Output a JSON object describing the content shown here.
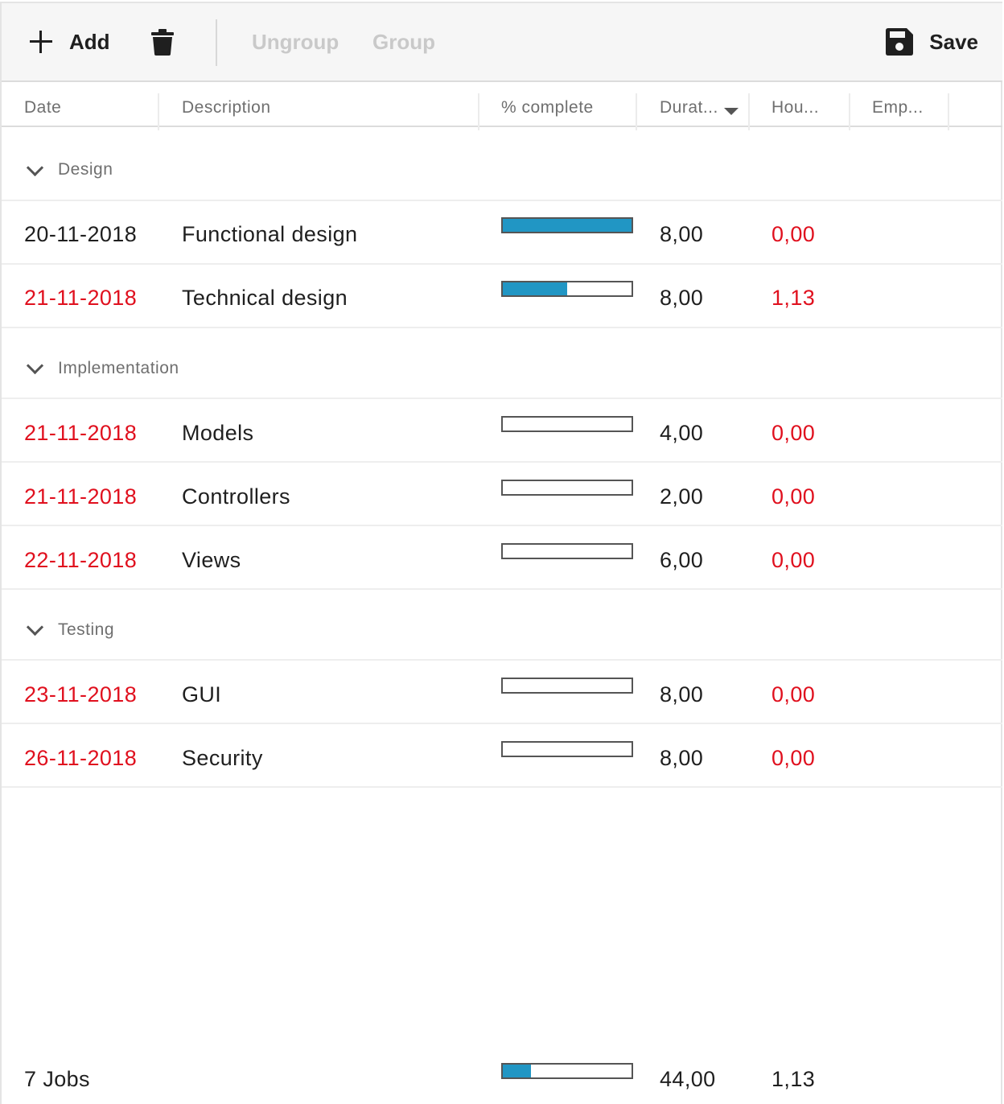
{
  "toolbar": {
    "add_label": "Add",
    "delete_icon": "trash-icon",
    "ungroup_label": "Ungroup",
    "group_label": "Group",
    "save_label": "Save",
    "save_icon": "floppy-disk-icon"
  },
  "columns": [
    "Date",
    "Description",
    "% complete",
    "Durat...",
    "Hou...",
    "Emp..."
  ],
  "sorted_column": "Durat...",
  "colors": {
    "accent": "#2196c4",
    "overdue": "#e0101e"
  },
  "groups": [
    {
      "name": "Design",
      "rows": [
        {
          "date": "20-11-2018",
          "date_overdue": false,
          "description": "Functional design",
          "complete": 1.0,
          "duration": "8,00",
          "hours": "0,00"
        },
        {
          "date": "21-11-2018",
          "date_overdue": true,
          "description": "Technical design",
          "complete": 0.5,
          "duration": "8,00",
          "hours": "1,13"
        }
      ]
    },
    {
      "name": "Implementation",
      "rows": [
        {
          "date": "21-11-2018",
          "date_overdue": true,
          "description": "Models",
          "complete": 0,
          "duration": "4,00",
          "hours": "0,00"
        },
        {
          "date": "21-11-2018",
          "date_overdue": true,
          "description": "Controllers",
          "complete": 0,
          "duration": "2,00",
          "hours": "0,00"
        },
        {
          "date": "22-11-2018",
          "date_overdue": true,
          "description": "Views",
          "complete": 0,
          "duration": "6,00",
          "hours": "0,00"
        }
      ]
    },
    {
      "name": "Testing",
      "rows": [
        {
          "date": "23-11-2018",
          "date_overdue": true,
          "description": "GUI",
          "complete": 0,
          "duration": "8,00",
          "hours": "0,00"
        },
        {
          "date": "26-11-2018",
          "date_overdue": true,
          "description": "Security",
          "complete": 0,
          "duration": "8,00",
          "hours": "0,00"
        }
      ]
    }
  ],
  "footer": {
    "count_label": "7 Jobs",
    "complete": 0.22,
    "duration_total": "44,00",
    "hours_total": "1,13"
  }
}
